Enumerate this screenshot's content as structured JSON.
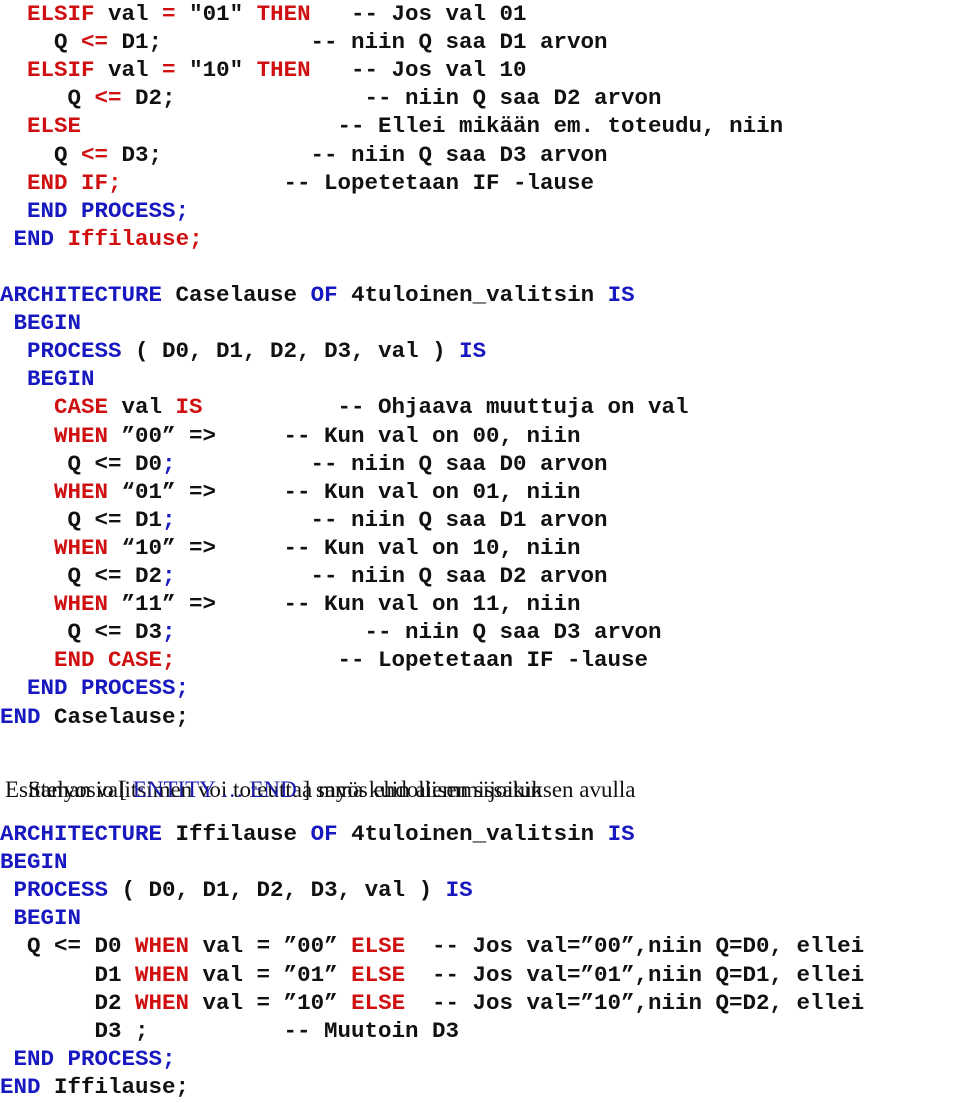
{
  "colors": {
    "keyword_red": "#d01010",
    "keyword_blue": "#1818c0",
    "text": "#111111",
    "prose_blue": "#1a1aa6"
  },
  "block_if_tail": {
    "lines": [
      {
        "indent": "  ",
        "tokens": [
          {
            "t": "ELSIF",
            "c": "red"
          },
          {
            "t": " val "
          },
          {
            "t": "=",
            "c": "red"
          },
          {
            "t": " \"01\" "
          },
          {
            "t": "THEN",
            "c": "red"
          }
        ],
        "comment_col": 26,
        "comment": "-- Jos val 01"
      },
      {
        "indent": "    ",
        "tokens": [
          {
            "t": "Q "
          },
          {
            "t": "<=",
            "c": "red"
          },
          {
            "t": " D1;"
          }
        ],
        "comment_col": 23,
        "comment": "-- niin Q saa D1 arvon"
      },
      {
        "indent": "  ",
        "tokens": [
          {
            "t": "ELSIF",
            "c": "red"
          },
          {
            "t": " val "
          },
          {
            "t": "=",
            "c": "red"
          },
          {
            "t": " \"10\" "
          },
          {
            "t": "THEN",
            "c": "red"
          }
        ],
        "comment_col": 26,
        "comment": "-- Jos val 10"
      },
      {
        "indent": "     ",
        "tokens": [
          {
            "t": "Q "
          },
          {
            "t": "<=",
            "c": "red"
          },
          {
            "t": " D2;"
          }
        ],
        "comment_col": 27,
        "comment": "-- niin Q saa D2 arvon"
      },
      {
        "indent": "  ",
        "tokens": [
          {
            "t": "ELSE",
            "c": "red"
          }
        ],
        "comment_col": 25,
        "comment": "-- Ellei mikään em. toteudu, niin"
      },
      {
        "indent": "    ",
        "tokens": [
          {
            "t": "Q "
          },
          {
            "t": "<=",
            "c": "red"
          },
          {
            "t": " D3;"
          }
        ],
        "comment_col": 23,
        "comment": "-- niin Q saa D3 arvon"
      },
      {
        "indent": "  ",
        "tokens": [
          {
            "t": "END IF;",
            "c": "red"
          }
        ],
        "comment_col": 21,
        "comment": "-- Lopetetaan IF -lause"
      },
      {
        "indent": "  ",
        "tokens": [
          {
            "t": "END PROCESS;",
            "c": "blue"
          }
        ]
      },
      {
        "indent": " ",
        "tokens": [
          {
            "t": "END",
            "c": "blue"
          },
          {
            "t": " "
          },
          {
            "t": "Iffilause;",
            "c": "red"
          }
        ]
      }
    ]
  },
  "block_case": {
    "lines": [
      {
        "indent": "",
        "tokens": [
          {
            "t": "ARCHITECTURE",
            "c": "blue"
          },
          {
            "t": " Caselause "
          },
          {
            "t": "OF",
            "c": "blue"
          },
          {
            "t": " 4tuloinen_valitsin "
          },
          {
            "t": "IS",
            "c": "blue"
          }
        ]
      },
      {
        "indent": " ",
        "tokens": [
          {
            "t": "BEGIN",
            "c": "blue"
          }
        ]
      },
      {
        "indent": "  ",
        "tokens": [
          {
            "t": "PROCESS",
            "c": "blue"
          },
          {
            "t": " ( D0, D1, D2, D3, val ) "
          },
          {
            "t": "IS",
            "c": "blue"
          }
        ]
      },
      {
        "indent": "  ",
        "tokens": [
          {
            "t": "BEGIN",
            "c": "blue"
          }
        ]
      },
      {
        "indent": "    ",
        "tokens": [
          {
            "t": "CASE",
            "c": "red"
          },
          {
            "t": " val "
          },
          {
            "t": "IS",
            "c": "red"
          }
        ],
        "comment_col": 25,
        "comment": "-- Ohjaava muuttuja on val"
      },
      {
        "indent": "    ",
        "tokens": [
          {
            "t": "WHEN",
            "c": "red"
          },
          {
            "t": " ”00” =>"
          }
        ],
        "comment_col": 21,
        "comment": "-- Kun val on 00, niin"
      },
      {
        "indent": "     ",
        "tokens": [
          {
            "t": "Q <= D0"
          },
          {
            "t": ";",
            "c": "blue"
          }
        ],
        "comment_col": 23,
        "comment": "-- niin Q saa D0 arvon"
      },
      {
        "indent": "    ",
        "tokens": [
          {
            "t": "WHEN",
            "c": "red"
          },
          {
            "t": " “01” =>"
          }
        ],
        "comment_col": 21,
        "comment": "-- Kun val on 01, niin"
      },
      {
        "indent": "     ",
        "tokens": [
          {
            "t": "Q <= D1"
          },
          {
            "t": ";",
            "c": "blue"
          }
        ],
        "comment_col": 23,
        "comment": "-- niin Q saa D1 arvon"
      },
      {
        "indent": "    ",
        "tokens": [
          {
            "t": "WHEN",
            "c": "red"
          },
          {
            "t": " “10” =>"
          }
        ],
        "comment_col": 21,
        "comment": "-- Kun val on 10, niin"
      },
      {
        "indent": "     ",
        "tokens": [
          {
            "t": "Q <= D2"
          },
          {
            "t": ";",
            "c": "blue"
          }
        ],
        "comment_col": 23,
        "comment": "-- niin Q saa D2 arvon"
      },
      {
        "indent": "    ",
        "tokens": [
          {
            "t": "WHEN",
            "c": "red"
          },
          {
            "t": " ”11” =>"
          }
        ],
        "comment_col": 21,
        "comment": "-- Kun val on 11, niin"
      },
      {
        "indent": "     ",
        "tokens": [
          {
            "t": "Q <= D3"
          },
          {
            "t": ";",
            "c": "blue"
          }
        ],
        "comment_col": 27,
        "comment": "-- niin Q saa D3 arvon"
      },
      {
        "indent": "    ",
        "tokens": [
          {
            "t": "END CASE;",
            "c": "red"
          }
        ],
        "comment_col": 25,
        "comment": "-- Lopetetaan IF -lause"
      },
      {
        "indent": "  ",
        "tokens": [
          {
            "t": "END PROCESS;",
            "c": "blue"
          }
        ]
      },
      {
        "indent": "",
        "tokens": [
          {
            "t": "END",
            "c": "blue"
          },
          {
            "t": " Caselause;"
          }
        ]
      }
    ]
  },
  "prose": {
    "line1": "Saman valitsimen voi toteuttaa myös ehdollisen sijoituksen avulla",
    "line2_before": "Esittelyosio [ ",
    "line2_highlight": "ENTITY … END",
    "line2_after": " ] sama kuin aiemmissakin"
  },
  "block_when_else": {
    "lines": [
      {
        "indent": "",
        "tokens": [
          {
            "t": "ARCHITECTURE",
            "c": "blue"
          },
          {
            "t": " Iffilause "
          },
          {
            "t": "OF",
            "c": "blue"
          },
          {
            "t": " 4tuloinen_valitsin "
          },
          {
            "t": "IS",
            "c": "blue"
          }
        ]
      },
      {
        "indent": "",
        "tokens": [
          {
            "t": "BEGIN",
            "c": "blue"
          }
        ]
      },
      {
        "indent": " ",
        "tokens": [
          {
            "t": "PROCESS",
            "c": "blue"
          },
          {
            "t": " ( D0, D1, D2, D3, val ) "
          },
          {
            "t": "IS",
            "c": "blue"
          }
        ]
      },
      {
        "indent": " ",
        "tokens": [
          {
            "t": "BEGIN",
            "c": "blue"
          }
        ]
      },
      {
        "indent": "  ",
        "tokens": [
          {
            "t": "Q <= D0 "
          },
          {
            "t": "WHEN",
            "c": "red"
          },
          {
            "t": " val = ”00” "
          },
          {
            "t": "ELSE",
            "c": "red"
          }
        ],
        "comment_col": 32,
        "comment": "-- Jos val=”00”,niin Q=D0, ellei"
      },
      {
        "indent": "       ",
        "tokens": [
          {
            "t": "D1 "
          },
          {
            "t": "WHEN",
            "c": "red"
          },
          {
            "t": " val = ”01” "
          },
          {
            "t": "ELSE",
            "c": "red"
          }
        ],
        "comment_col": 32,
        "comment": "-- Jos val=”01”,niin Q=D1, ellei"
      },
      {
        "indent": "       ",
        "tokens": [
          {
            "t": "D2 "
          },
          {
            "t": "WHEN",
            "c": "red"
          },
          {
            "t": " val = ”10” "
          },
          {
            "t": "ELSE",
            "c": "red"
          }
        ],
        "comment_col": 32,
        "comment": "-- Jos val=”10”,niin Q=D2, ellei"
      },
      {
        "indent": "       ",
        "tokens": [
          {
            "t": "D3 ;"
          }
        ],
        "comment_col": 21,
        "comment": "-- Muutoin D3"
      },
      {
        "indent": " ",
        "tokens": [
          {
            "t": "END PROCESS;",
            "c": "blue"
          }
        ]
      },
      {
        "indent": "",
        "tokens": [
          {
            "t": "END",
            "c": "blue"
          },
          {
            "t": " Iffilause;"
          }
        ]
      }
    ]
  }
}
